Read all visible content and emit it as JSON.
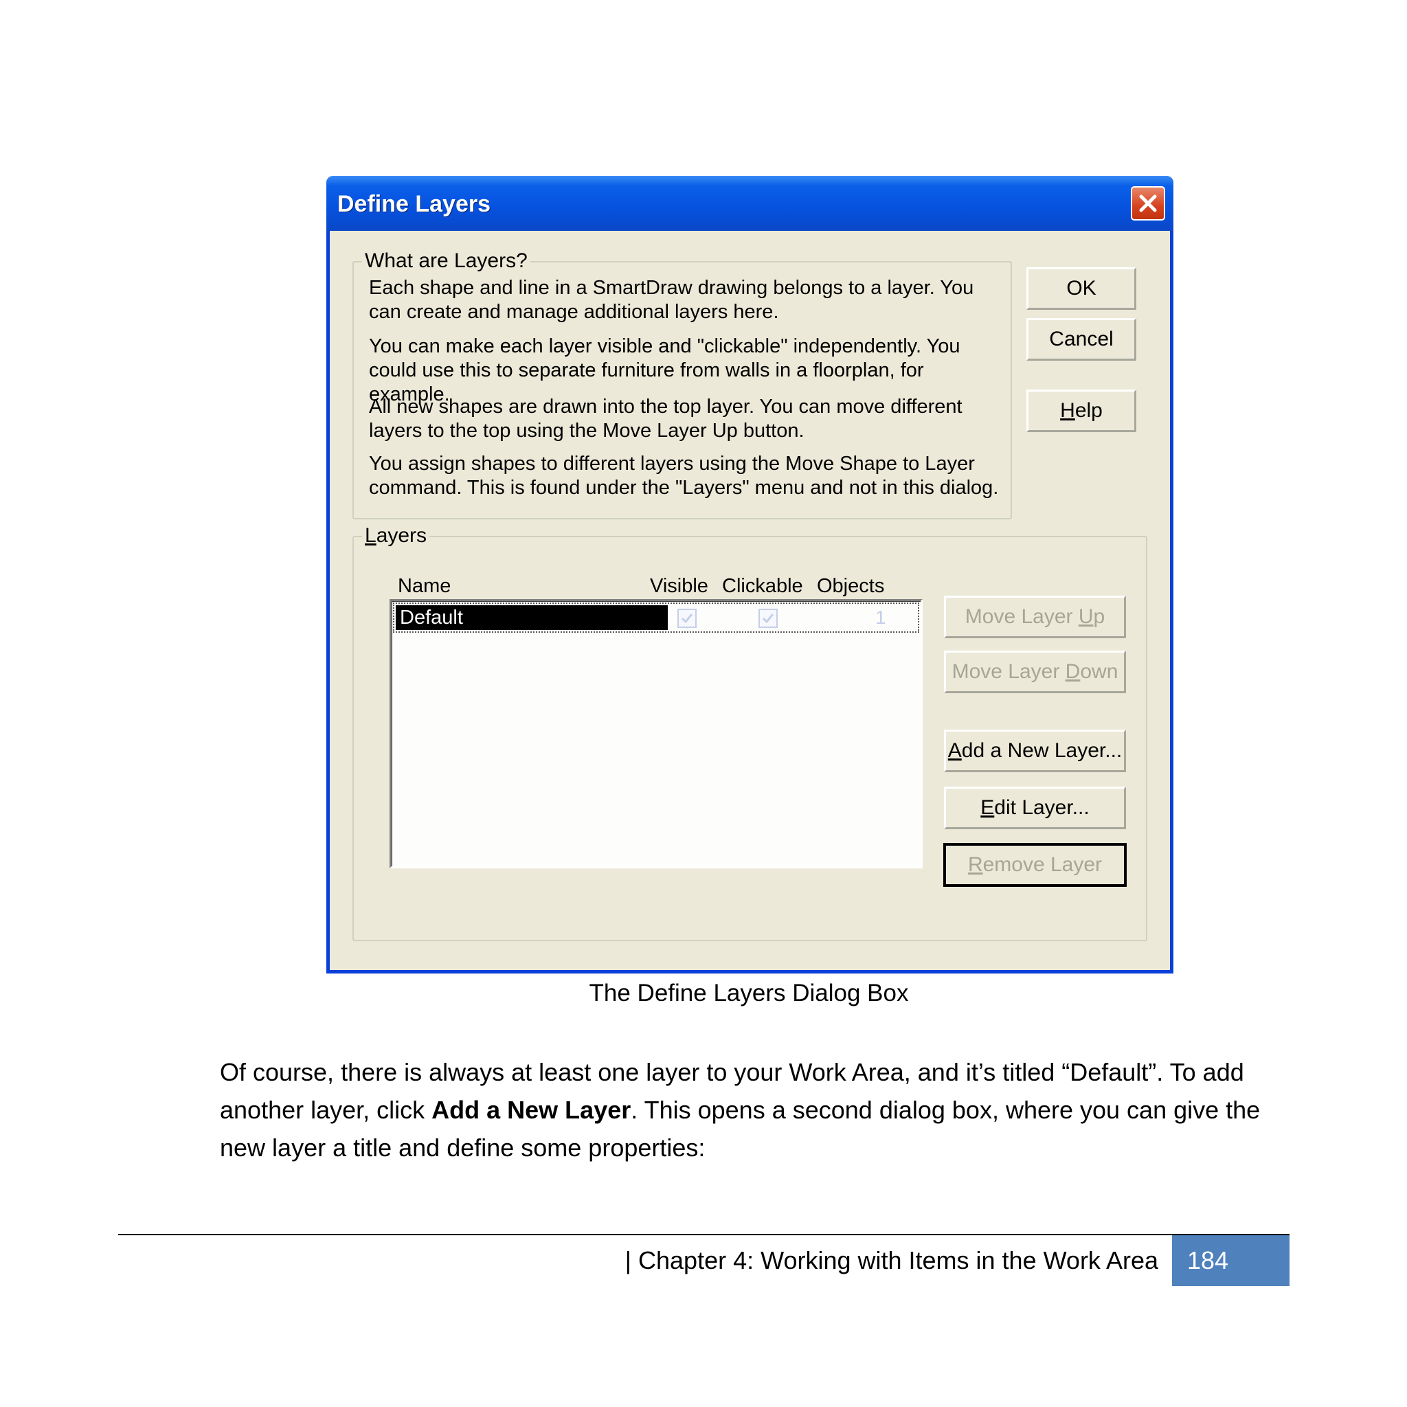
{
  "dialog": {
    "title": "Define Layers",
    "about": {
      "legend": "What are Layers?",
      "paragraphs": [
        "Each shape and line in a SmartDraw drawing belongs to a layer. You can create and manage additional layers here.",
        "You can make each layer visible and \"clickable\" independently. You could use this to separate furniture from walls in a floorplan, for example.",
        "All new shapes are drawn into the top layer. You can move different layers to the top using the Move Layer Up button.",
        "You assign shapes to different layers using the Move Shape to Layer command. This is found under the \"Layers\" menu and not in this dialog."
      ]
    },
    "buttons": {
      "ok": "OK",
      "cancel": "Cancel",
      "help_mnemonic": "H",
      "help_rest": "elp"
    },
    "layers": {
      "legend_mnemonic": "L",
      "legend_rest": "ayers",
      "columns": {
        "name": "Name",
        "visible": "Visible",
        "clickable": "Clickable",
        "objects": "Objects"
      },
      "rows": [
        {
          "name": "Default",
          "visible": true,
          "clickable": true,
          "objects": "1"
        }
      ],
      "move_up_pre": "Move Layer ",
      "move_up_mnemonic": "U",
      "move_up_post": "p",
      "move_down_pre": "Move Layer ",
      "move_down_mnemonic": "D",
      "move_down_post": "own",
      "add_mnemonic": "A",
      "add_rest": "dd a New Layer...",
      "edit_mnemonic": "E",
      "edit_rest": "dit Layer...",
      "remove_mnemonic": "R",
      "remove_rest": "emove Layer"
    }
  },
  "document": {
    "caption": "The Define Layers Dialog Box",
    "body_part1": "Of course, there is always at least one layer to your Work Area, and it’s titled “Default”.  To add another layer, click ",
    "body_bold": "Add a New Layer",
    "body_part2": ".  This opens a second dialog box, where you can give the new layer a title and define some properties:",
    "footer_chapter": "| Chapter 4: Working with Items in the Work Area",
    "page_number": "184"
  },
  "colors": {
    "titlebar": "#0651de",
    "dialog_face": "#ece9d8",
    "close_button": "#d5411d",
    "page_number_box": "#4f81bd"
  }
}
